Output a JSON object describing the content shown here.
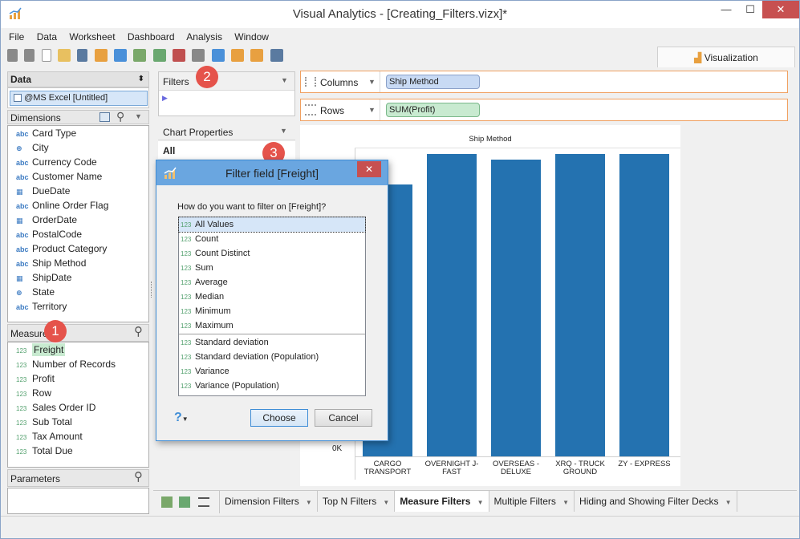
{
  "window": {
    "title": "Visual Analytics - [Creating_Filters.vizx]*",
    "minimize_glyph": "—",
    "maximize_glyph": "☐",
    "close_glyph": "✕"
  },
  "menu": [
    "File",
    "Data",
    "Worksheet",
    "Dashboard",
    "Analysis",
    "Window"
  ],
  "viz_tab": {
    "label": "Visualization"
  },
  "data_panel": {
    "header": "Data",
    "datasource": "@MS Excel [Untitled]",
    "dimensions_label": "Dimensions",
    "dimensions": [
      {
        "type": "abc",
        "label": "Card Type"
      },
      {
        "type": "geo",
        "label": "City"
      },
      {
        "type": "abc",
        "label": "Currency Code"
      },
      {
        "type": "abc",
        "label": "Customer Name"
      },
      {
        "type": "date",
        "label": "DueDate"
      },
      {
        "type": "abc",
        "label": "Online Order Flag"
      },
      {
        "type": "date",
        "label": "OrderDate"
      },
      {
        "type": "abc",
        "label": "PostalCode"
      },
      {
        "type": "abc",
        "label": "Product Category"
      },
      {
        "type": "abc",
        "label": "Ship Method"
      },
      {
        "type": "date",
        "label": "ShipDate"
      },
      {
        "type": "geo",
        "label": "State"
      },
      {
        "type": "abc",
        "label": "Territory"
      }
    ],
    "measures_label": "Measures",
    "measures": [
      {
        "type": "123",
        "label": "Freight"
      },
      {
        "type": "123",
        "label": "Number of Records"
      },
      {
        "type": "123",
        "label": "Profit"
      },
      {
        "type": "123",
        "label": "Row"
      },
      {
        "type": "123",
        "label": "Sales Order ID"
      },
      {
        "type": "123",
        "label": "Sub Total"
      },
      {
        "type": "123",
        "label": "Tax Amount"
      },
      {
        "type": "123",
        "label": "Total Due"
      }
    ],
    "parameters_label": "Parameters"
  },
  "filters_panel": {
    "label": "Filters"
  },
  "chart_properties": {
    "label": "Chart Properties",
    "all_label": "All"
  },
  "shelves": {
    "columns_label": "Columns",
    "columns_pill": "Ship Method",
    "rows_label": "Rows",
    "rows_pill": "SUM(Profit)"
  },
  "badges": [
    "1",
    "2",
    "3"
  ],
  "chart_data": {
    "type": "bar",
    "title": "Ship Method",
    "categories": [
      "CARGO TRANSPORT",
      "OVERNIGHT J-FAST",
      "OVERSEAS - DELUXE",
      "XRQ - TRUCK GROUND",
      "ZY - EXPRESS"
    ],
    "category_labels": [
      [
        "CARGO",
        "TRANSPORT"
      ],
      [
        "OVERNIGHT J-",
        "FAST"
      ],
      [
        "OVERSEAS -",
        "DELUXE"
      ],
      [
        "XRQ - TRUCK",
        "GROUND"
      ],
      [
        "ZY - EXPRESS",
        ""
      ]
    ],
    "values": [
      0.88,
      0.98,
      0.96,
      0.98,
      0.98
    ],
    "ytick_visible": "0K",
    "color": "#2472b0"
  },
  "dialog": {
    "title": "Filter field [Freight]",
    "question": "How do you want to filter on [Freight]?",
    "options_group1": [
      "All Values",
      "Count",
      "Count Distinct",
      "Sum",
      "Average",
      "Median",
      "Minimum",
      "Maximum"
    ],
    "options_group2": [
      "Standard deviation",
      "Standard deviation (Population)",
      "Variance",
      "Variance (Population)"
    ],
    "option_type": "123",
    "selected": "All Values",
    "help_glyph": "?",
    "choose_label": "Choose",
    "cancel_label": "Cancel"
  },
  "sheet_tabs": [
    "Dimension Filters",
    "Top N Filters",
    "Measure Filters",
    "Multiple Filters",
    "Hiding and Showing Filter Decks"
  ],
  "active_tab": "Measure Filters",
  "colors": {
    "accent": "#3f8dd6",
    "badge": "#e5534b",
    "bar": "#2472b0",
    "shelf_border": "#f0a060"
  }
}
